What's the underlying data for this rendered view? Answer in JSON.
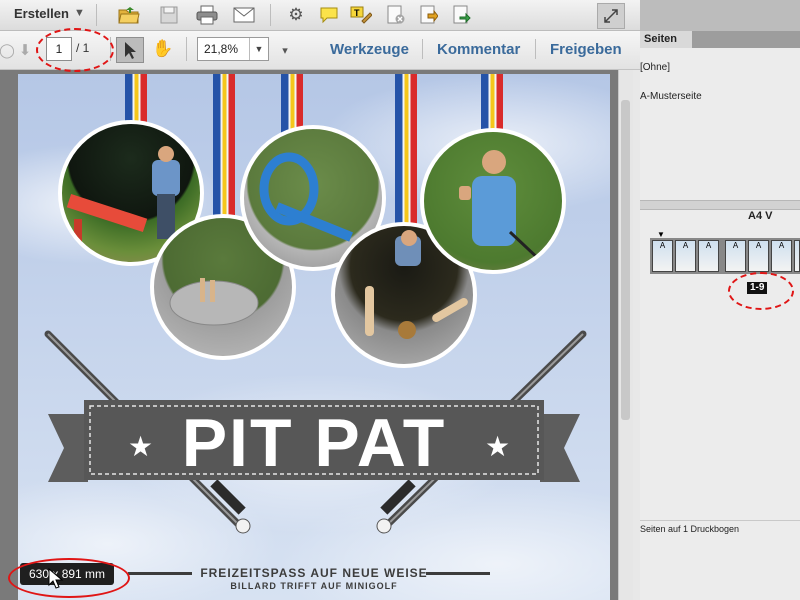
{
  "toolbar": {
    "create_label": "Erstellen",
    "page_current": "1",
    "page_total": "/ 1",
    "zoom_value": "21,8%",
    "menu": {
      "tools": "Werkzeuge",
      "comment": "Kommentar",
      "share": "Freigeben"
    }
  },
  "document": {
    "title": "PIT PAT",
    "tagline": "FREIZEITSPASS AUF NEUE WEISE",
    "subtagline": "BILLARD TRIFFT AUF MINIGOLF"
  },
  "tooltip": {
    "size": "630 x 891 mm"
  },
  "pages_panel": {
    "tab_label": "Seiten",
    "none_item": "[Ohne]",
    "master_item": "A-Musterseite",
    "format_label": "A4 V",
    "page_letter": "A",
    "range_badge": "1-9",
    "status": "Seiten auf 1 Druckbogen"
  },
  "colors": {
    "link_blue": "#3a6a9b",
    "highlight_red": "#e01515",
    "ribbon_blue": "#2553a8",
    "ribbon_yellow": "#f5c61b",
    "ribbon_red": "#d92b2b"
  },
  "icons": [
    "open-folder-icon",
    "save-icon",
    "print-icon",
    "mail-icon",
    "gear-icon",
    "comment-icon",
    "highlight-icon",
    "delete-page-icon",
    "export-icon",
    "share-page-icon",
    "fullscreen-icon",
    "prev-page-icon",
    "next-page-icon",
    "select-arrow-icon",
    "hand-icon"
  ]
}
